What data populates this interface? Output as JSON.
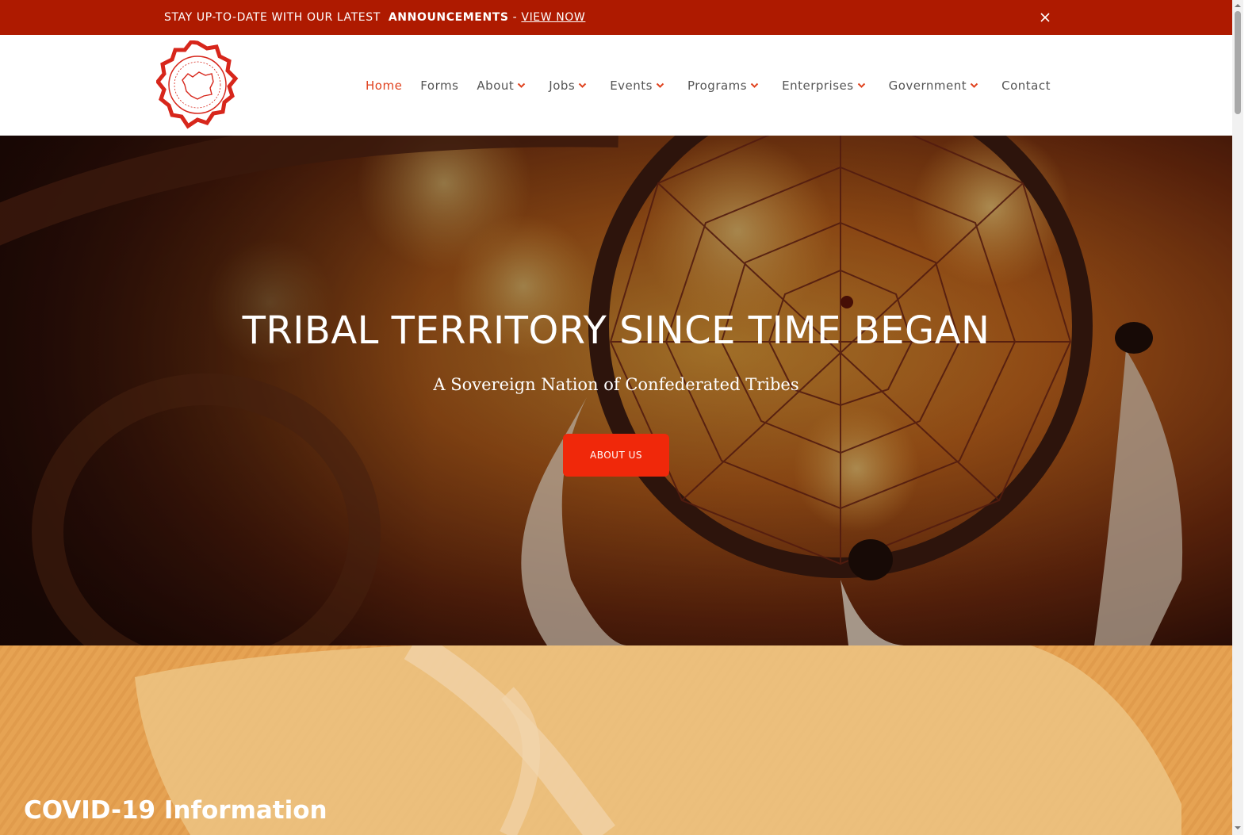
{
  "announcement": {
    "lead": "STAY UP-TO-DATE WITH OUR LATEST",
    "strong": "ANNOUNCEMENTS",
    "separator": " - ",
    "link": "VIEW NOW",
    "close_icon": "close-icon",
    "background": "#ae1a00"
  },
  "header": {
    "logo_icon": "tribal-seal-logo",
    "nav": [
      {
        "label": "Home",
        "active": true
      },
      {
        "label": "Forms"
      },
      {
        "label": "About",
        "dropdown": true
      },
      {
        "label": "Jobs",
        "dropdown": true
      },
      {
        "label": "Events",
        "dropdown": true
      },
      {
        "label": "Programs",
        "dropdown": true
      },
      {
        "label": "Enterprises",
        "dropdown": true
      },
      {
        "label": "Government",
        "dropdown": true
      },
      {
        "label": "Contact"
      }
    ],
    "accent": "#e0421e"
  },
  "hero": {
    "title": "TRIBAL TERRITORY SINCE TIME BEGAN",
    "subtitle": "A Sovereign Nation of Confederated Tribes",
    "button": "ABOUT US",
    "button_color": "#f0280a"
  },
  "covid": {
    "title": "COVID-19 Information"
  }
}
